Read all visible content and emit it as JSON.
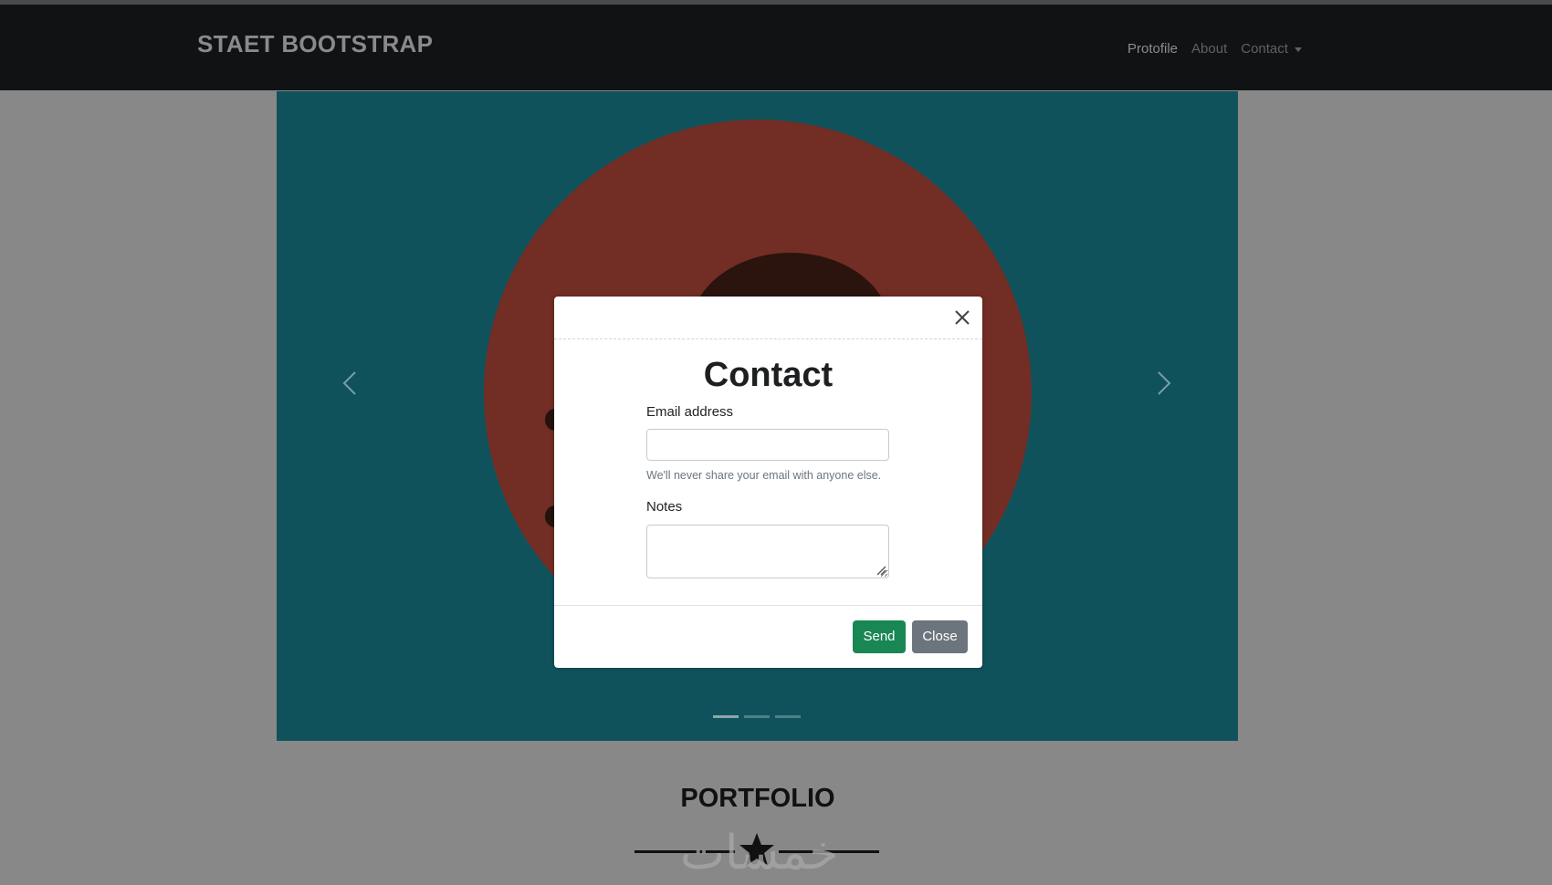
{
  "navbar": {
    "brand": "STAET BOOTSTRAP",
    "items": [
      {
        "label": "Protofile",
        "active": true
      },
      {
        "label": "About",
        "active": false
      },
      {
        "label": "Contact",
        "active": false,
        "dropdown": true
      }
    ]
  },
  "carousel": {
    "indicators": 3,
    "active_index": 0,
    "prev_icon": "chevron-left-icon",
    "next_icon": "chevron-right-icon"
  },
  "section": {
    "title": "PORTFOLIO",
    "divider_icon": "star-icon"
  },
  "watermark": "خمسات",
  "modal": {
    "title": "Contact",
    "email_label": "Email address",
    "email_value": "",
    "email_help": "We'll never share your email with anyone else.",
    "notes_label": "Notes",
    "notes_value": "",
    "send_label": "Send",
    "close_label": "Close",
    "close_icon": "close-icon"
  },
  "colors": {
    "navbar_bg": "#111214",
    "carousel_bg": "#10525b",
    "circle": "#722d24",
    "send_button": "#198754",
    "close_button": "#6c757d",
    "backdrop": "#888888"
  }
}
